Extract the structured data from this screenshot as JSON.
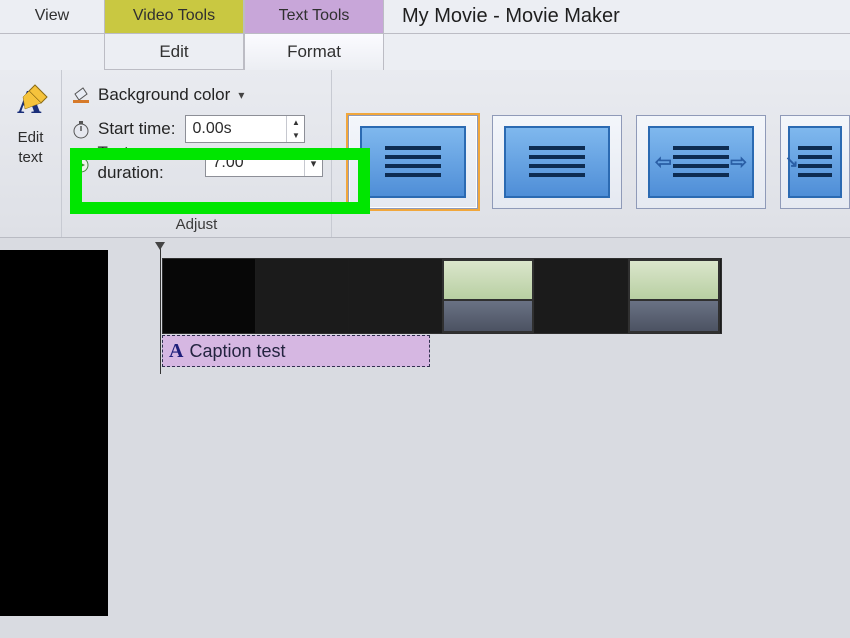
{
  "window_title": "My Movie - Movie Maker",
  "tabs": {
    "view": "View",
    "video_tools": "Video Tools",
    "text_tools": "Text Tools",
    "video_sub": "Edit",
    "text_sub": "Format"
  },
  "edit_text": {
    "line1": "Edit",
    "line2": "text"
  },
  "adjust": {
    "background_color": "Background color",
    "start_time_label": "Start time:",
    "start_time_value": "0.00s",
    "text_duration_label": "Text duration:",
    "text_duration_value": "7.00",
    "group_label": "Adjust"
  },
  "timeline": {
    "caption_text": "Caption test"
  }
}
